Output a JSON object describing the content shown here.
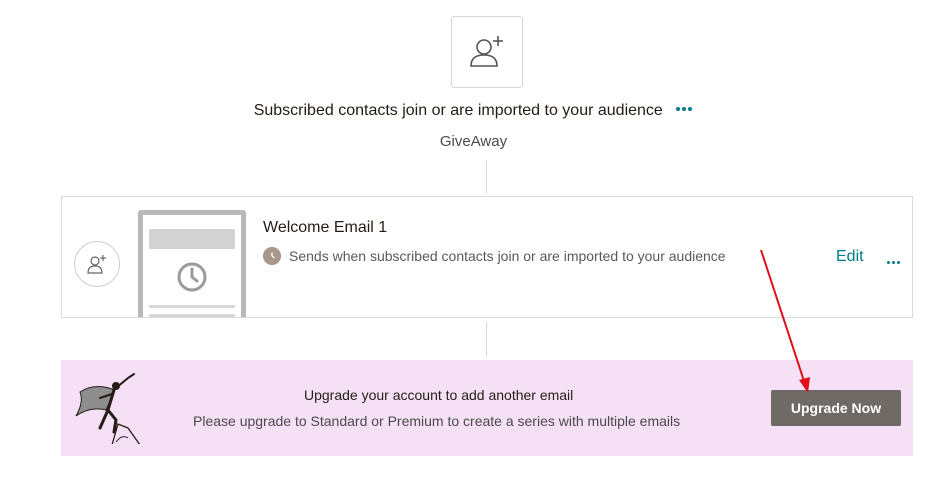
{
  "trigger": {
    "icon": "add-user-icon",
    "title": "Subscribed contacts join or are imported to your audience",
    "audience": "GiveAway"
  },
  "email_card": {
    "avatar_icon": "add-user-icon",
    "name": "Welcome Email 1",
    "status_icon": "clock-icon",
    "status_text": "Sends when subscribed contacts join or are imported to your audience",
    "edit_label": "Edit"
  },
  "upgrade_banner": {
    "title": "Upgrade your account to add another email",
    "text": "Please upgrade to Standard or Premium to create a series with multiple emails",
    "button_label": "Upgrade Now",
    "illustration": "superhero-illustration"
  },
  "colors": {
    "accent": "#007c89",
    "banner_bg": "#f6e0f6",
    "button_bg": "#6f6a66",
    "annotation": "#e0101a"
  }
}
